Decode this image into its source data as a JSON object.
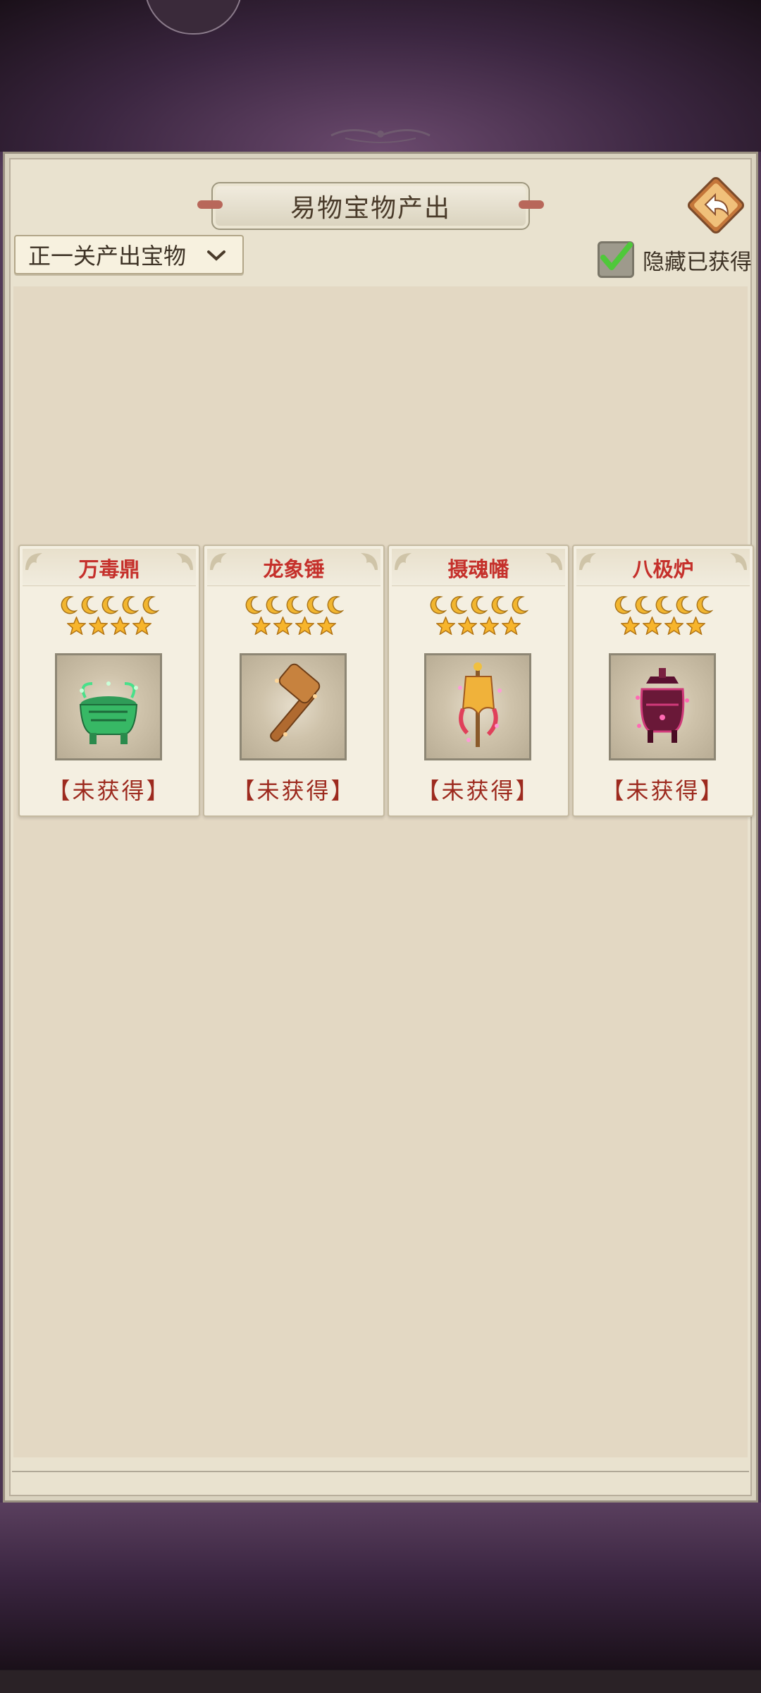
{
  "panel": {
    "title": "易物宝物产出",
    "filter_dropdown": {
      "selected": "正一关产出宝物"
    },
    "hide_obtained": {
      "label": "隐藏已获得",
      "checked": true
    }
  },
  "treasures": [
    {
      "name": "万毒鼎",
      "moons": 5,
      "stars": 4,
      "status": "【未获得】",
      "icon": "green-cauldron"
    },
    {
      "name": "龙象锤",
      "moons": 5,
      "stars": 4,
      "status": "【未获得】",
      "icon": "bronze-hammer"
    },
    {
      "name": "摄魂幡",
      "moons": 5,
      "stars": 4,
      "status": "【未获得】",
      "icon": "soul-banner"
    },
    {
      "name": "八极炉",
      "moons": 5,
      "stars": 4,
      "status": "【未获得】",
      "icon": "magenta-furnace"
    }
  ],
  "colors": {
    "name_red": "#c5302b",
    "status_red": "#9d2a1e",
    "panel_bg": "#e3d8c3",
    "check_green": "#4fc83a"
  }
}
